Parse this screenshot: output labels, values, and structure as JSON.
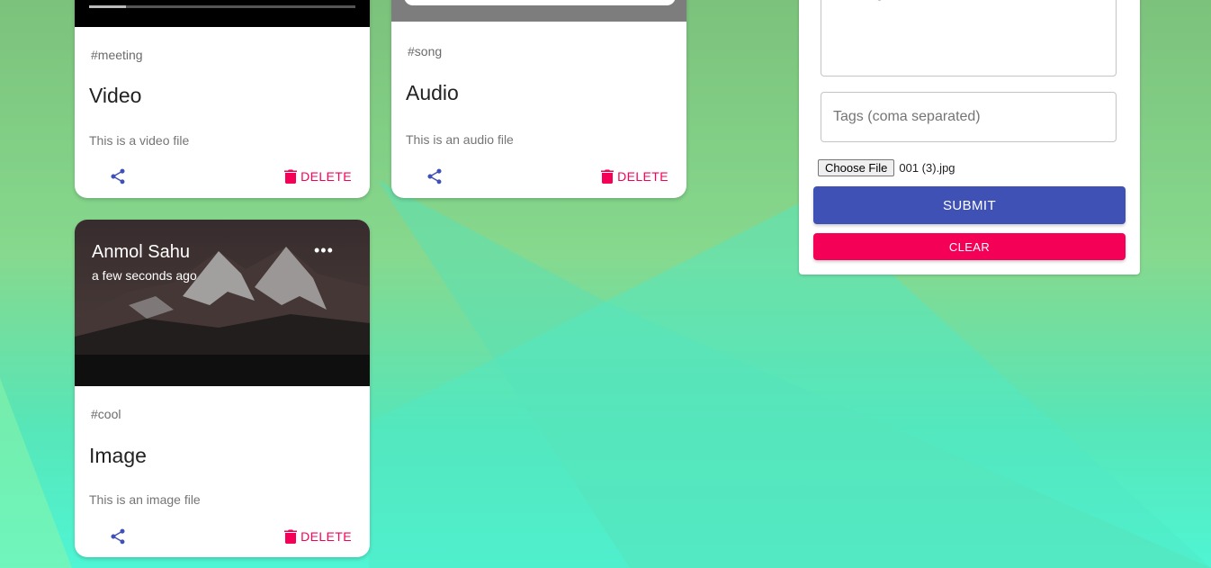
{
  "colors": {
    "primary": "#3f51b5",
    "secondary": "#f50057",
    "card_text": "#222222"
  },
  "posts": [
    {
      "media_type": "video",
      "video_progress": 0.14,
      "tags": "#meeting",
      "title": "Video",
      "message": "This is a video file",
      "delete_label": "DELETE"
    },
    {
      "media_type": "audio",
      "tags": "#song",
      "title": "Audio",
      "message": "This is an audio file",
      "delete_label": "DELETE"
    },
    {
      "media_type": "image",
      "creator": "Anmol Sahu",
      "created_at": "a few seconds ago",
      "more_icon": "•••",
      "tags": "#cool",
      "title": "Image",
      "message": "This is an image file",
      "delete_label": "DELETE"
    }
  ],
  "form": {
    "message_placeholder": "Message",
    "tags_placeholder": "Tags (coma separated)",
    "choose_file_label": "Choose File",
    "file_name": "001 (3).jpg",
    "submit_label": "SUBMIT",
    "clear_label": "CLEAR"
  }
}
